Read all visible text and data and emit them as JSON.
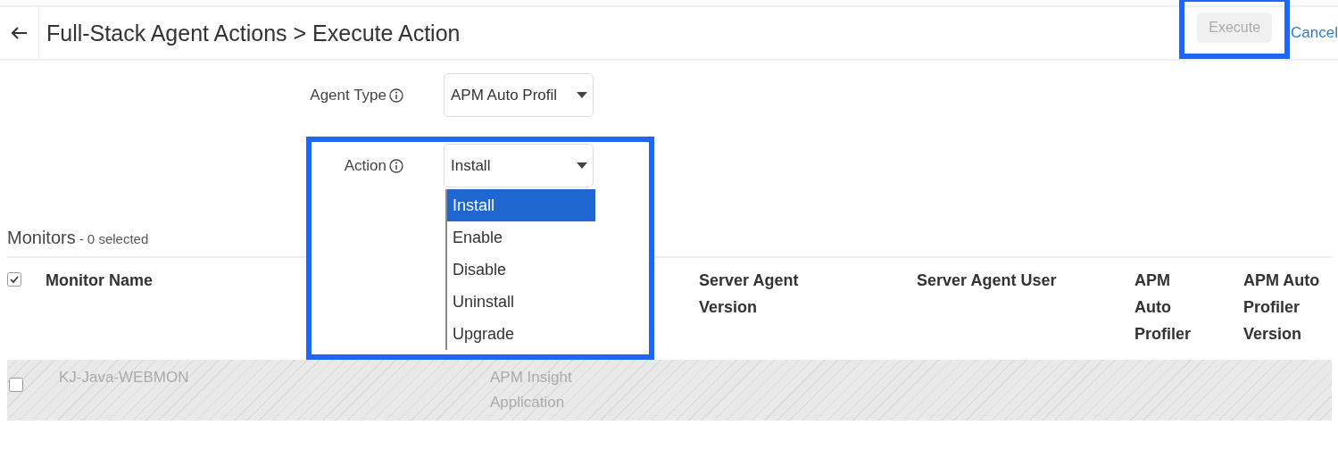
{
  "header": {
    "title": "Full-Stack Agent Actions > Execute Action",
    "execute_button": {
      "label": "Execute",
      "disabled": true,
      "highlighted": true
    },
    "cancel_link": "Cancel"
  },
  "form": {
    "agent_type": {
      "label": "Agent Type",
      "value": "APM Auto Profil"
    },
    "action": {
      "label": "Action",
      "value": "Install",
      "highlighted": true,
      "options": [
        {
          "label": "Install",
          "selected": true
        },
        {
          "label": "Enable",
          "selected": false
        },
        {
          "label": "Disable",
          "selected": false
        },
        {
          "label": "Uninstall",
          "selected": false
        },
        {
          "label": "Upgrade",
          "selected": false
        }
      ]
    }
  },
  "monitors": {
    "title": "Monitors",
    "count": "- 0 selected",
    "header_checked": true,
    "columns": [
      "Monitor Name",
      "Server Agent Version",
      "Server Agent User",
      "APM Auto Profiler",
      "APM Auto Profiler Version"
    ],
    "rows": [
      {
        "checked": false,
        "disabled": true,
        "cells": [
          "KJ-Java-WEBMON",
          "APM Insight Application"
        ]
      }
    ]
  }
}
